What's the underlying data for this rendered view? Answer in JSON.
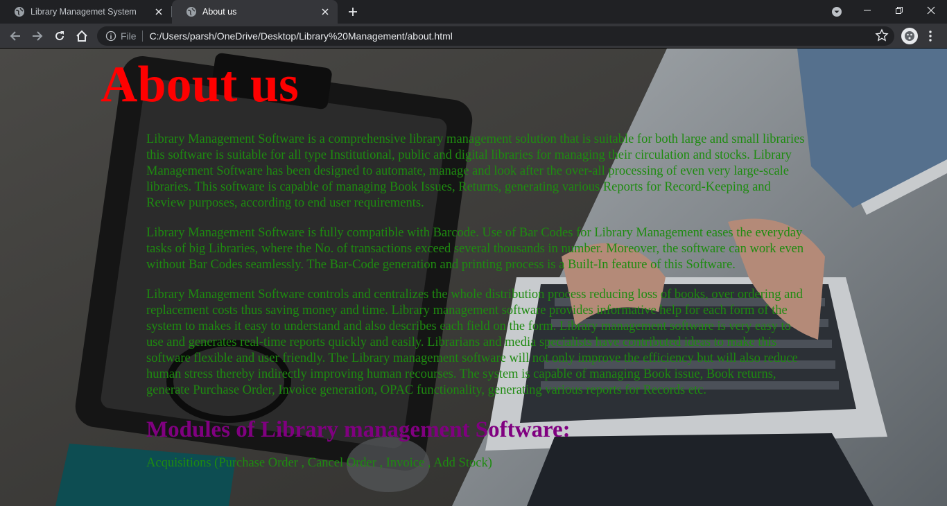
{
  "browser": {
    "tabs": [
      {
        "title": "Library Managemet System",
        "active": false
      },
      {
        "title": "About us",
        "active": true
      }
    ],
    "address": {
      "scheme_label": "File",
      "url": "C:/Users/parsh/OneDrive/Desktop/Library%20Management/about.html"
    }
  },
  "page": {
    "title": "About us",
    "paragraphs": [
      "Library Management Software is a comprehensive library management solution that is suitable for both large and small libraries this software is suitable for all type Institutional, public and digital libraries for managing their circulation and stocks. Library Management Software has been designed to automate, manage and look after the over-all processing of even very large-scale libraries. This software is capable of managing Book Issues, Returns, generating various Reports for Record-Keeping and Review purposes, according to end user requirements.",
      "Library Management Software is fully compatible with Barcode. Use of Bar Codes for Library Management eases the everyday tasks of big Libraries, where the No. of transactions exceed several thousands in number. Moreover, the software can work even without Bar Codes seamlessly. The Bar-Code generation and printing process is a Built-In feature of this Software.",
      "Library Management Software controls and centralizes the whole distribution process reducing loss of books, over ordering and replacement costs thus saving money and time. Library management software provides informative help for each form of the system to makes it easy to understand and also describes each field on the form. Library management software is very easy to use and generates real-time reports quickly and easily. Librarians and media specialists have contributed ideas to make this software flexible and user friendly. The Library management software will not only improve the efficiency but will also reduce human stress thereby indirectly improving human recourses. The system is capable of managing Book issue, Book returns, generate Purchase Order, Invoice generation, OPAC functionality, generating various reports for Records etc."
    ],
    "modules_heading": "Modules of Library management Software:",
    "modules": [
      "Acquisitions (Purchase Order , Cancel Order , Invoice , Add Stock)"
    ]
  },
  "colors": {
    "title": "#ff0000",
    "body_text": "#1e8b10",
    "heading": "#800080"
  },
  "icons": [
    "globe-icon",
    "close-icon",
    "plus-icon",
    "back-arrow-icon",
    "forward-arrow-icon",
    "reload-icon",
    "home-icon",
    "info-icon",
    "star-icon",
    "profile-icon",
    "more-icon",
    "minimize-icon",
    "maximize-icon",
    "tab-search-icon"
  ]
}
